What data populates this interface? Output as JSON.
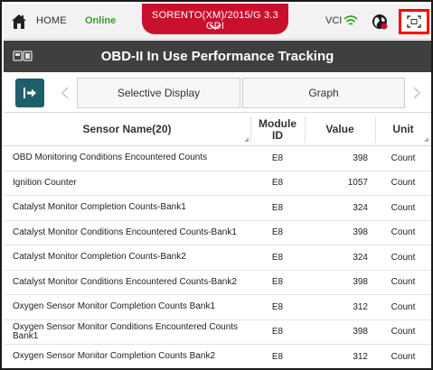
{
  "header": {
    "home_label": "HOME",
    "status": "Online",
    "vehicle": "SORENTO(XM)/2015/G 3.3 GDI",
    "vci_label": "VCI",
    "status_color": "#3a9b2a",
    "accent_color": "#c8102e"
  },
  "title": "OBD-II In Use Performance Tracking",
  "toolbar": {
    "selective_display": "Selective Display",
    "graph": "Graph"
  },
  "table": {
    "columns": {
      "name": "Sensor Name(20)",
      "module_line1": "Module",
      "module_line2": "ID",
      "value": "Value",
      "unit": "Unit"
    },
    "rows": [
      {
        "name": "OBD Monitoring Conditions Encountered Counts",
        "module": "E8",
        "value": "398",
        "unit": "Count"
      },
      {
        "name": "Ignition Counter",
        "module": "E8",
        "value": "1057",
        "unit": "Count"
      },
      {
        "name": "Catalyst Monitor Completion Counts-Bank1",
        "module": "E8",
        "value": "324",
        "unit": "Count"
      },
      {
        "name": "Catalyst Monitor Conditions Encountered Counts-Bank1",
        "module": "E8",
        "value": "398",
        "unit": "Count"
      },
      {
        "name": "Catalyst Monitor Completion Counts-Bank2",
        "module": "E8",
        "value": "324",
        "unit": "Count"
      },
      {
        "name": "Catalyst Monitor Conditions Encountered Counts-Bank2",
        "module": "E8",
        "value": "398",
        "unit": "Count"
      },
      {
        "name": "Oxygen Sensor Monitor Completion Counts Bank1",
        "module": "E8",
        "value": "312",
        "unit": "Count"
      },
      {
        "name": "Oxygen Sensor Monitor Conditions Encountered Counts Bank1",
        "module": "E8",
        "value": "398",
        "unit": "Count"
      },
      {
        "name": "Oxygen Sensor Monitor Completion Counts Bank2",
        "module": "E8",
        "value": "312",
        "unit": "Count"
      }
    ]
  },
  "icons": {
    "home": "home-icon",
    "chevron": "chevron-down-icon",
    "vci": "wifi-signal-icon",
    "globe": "globe-icon",
    "fullscreen": "fullscreen-icon",
    "title": "vehicle-scan-icon",
    "exit": "exit-icon",
    "prev": "chevron-left-icon",
    "next": "chevron-right-icon"
  }
}
